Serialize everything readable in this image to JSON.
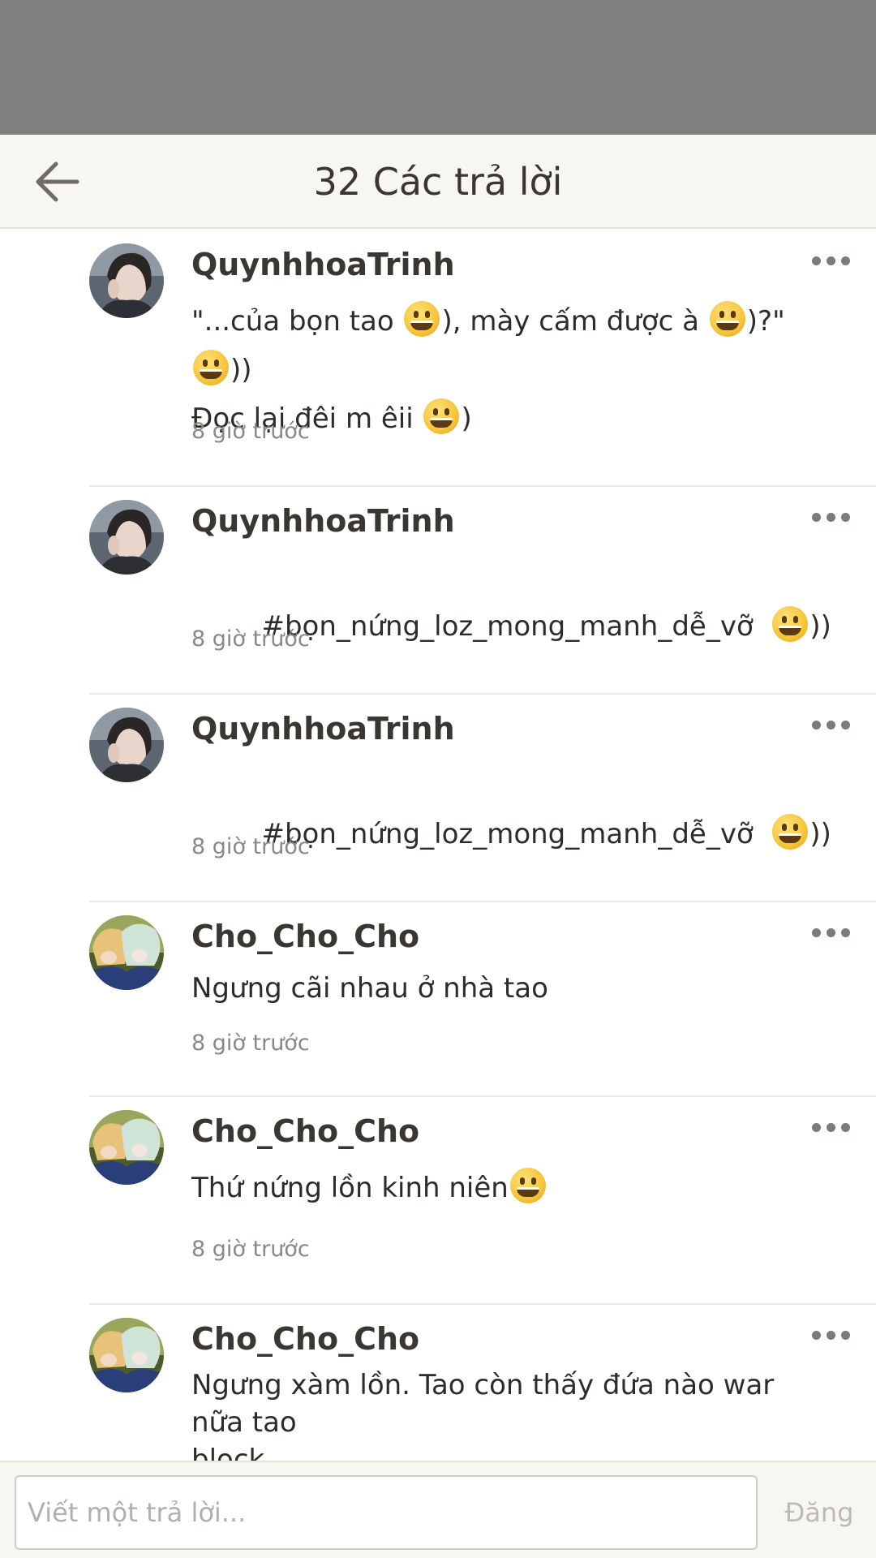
{
  "header": {
    "title": "32 Các trả lời"
  },
  "replies": [
    {
      "username": "QuynhhoaTrinh",
      "avatar": "girl-photo",
      "lines": [
        [
          {
            "t": "\"...của bọn tao "
          },
          {
            "emoji": "grinning-face"
          },
          {
            "t": "), mày cấm được à "
          },
          {
            "emoji": "grinning-face"
          },
          {
            "t": ")?\" "
          },
          {
            "emoji": "grinning-face"
          },
          {
            "t": "))"
          }
        ],
        [
          {
            "t": "Đọc lại đêi m êii "
          },
          {
            "emoji": "grinning-face"
          },
          {
            "t": ")"
          }
        ]
      ],
      "time": "8 giờ trước"
    },
    {
      "username": "QuynhhoaTrinh",
      "avatar": "girl-photo",
      "lines": [
        [
          {
            "t": "#bọn_nứng_loz_mong_manh_dễ_vỡ  "
          },
          {
            "emoji": "grinning-face"
          },
          {
            "t": "))"
          }
        ]
      ],
      "time": "8 giờ trước"
    },
    {
      "username": "QuynhhoaTrinh",
      "avatar": "girl-photo",
      "lines": [
        [
          {
            "t": "#bọn_nứng_loz_mong_manh_dễ_vỡ  "
          },
          {
            "emoji": "grinning-face"
          },
          {
            "t": "))"
          }
        ]
      ],
      "time": "8 giờ trước"
    },
    {
      "username": "Cho_Cho_Cho",
      "avatar": "anime-duo",
      "lines": [
        [
          {
            "t": "Ngưng cãi nhau ở nhà tao"
          }
        ]
      ],
      "time": "8 giờ trước"
    },
    {
      "username": "Cho_Cho_Cho",
      "avatar": "anime-duo",
      "lines": [
        [
          {
            "t": "Thứ nứng lồn kinh niên"
          },
          {
            "emoji": "grinning-face"
          }
        ]
      ],
      "time": "8 giờ trước"
    },
    {
      "username": "Cho_Cho_Cho",
      "avatar": "anime-duo",
      "lines": [
        [
          {
            "t": "Ngưng xàm lồn. Tao còn thấy đứa nào war nữa tao"
          }
        ],
        [
          {
            "t": "block"
          }
        ]
      ],
      "time": ""
    }
  ],
  "composer": {
    "placeholder": "Viết một trả lời...",
    "post_label": "Đăng"
  },
  "colors": {
    "status_bar": "#808080",
    "header_bg": "#f7f6f1",
    "divider": "#e9e7e2",
    "text_primary": "#2f2b28",
    "text_secondary": "#8c8883",
    "post_disabled": "#bdb9b3"
  }
}
